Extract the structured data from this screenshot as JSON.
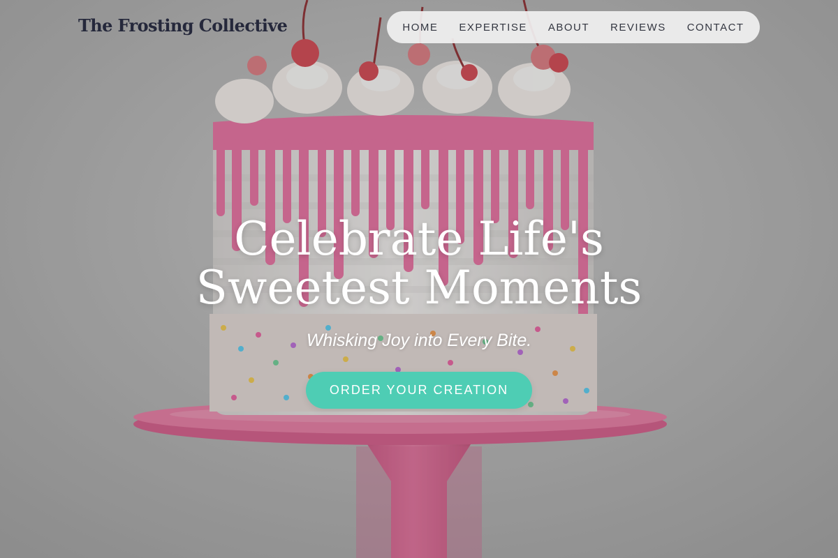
{
  "brand": {
    "name": "The Frosting Collective"
  },
  "nav": {
    "items": [
      {
        "label": "HOME"
      },
      {
        "label": "EXPERTISE"
      },
      {
        "label": "ABOUT"
      },
      {
        "label": "REVIEWS"
      },
      {
        "label": "CONTACT"
      }
    ]
  },
  "hero": {
    "title_line1": "Celebrate Life's",
    "title_line2": "Sweetest Moments",
    "tagline": "Whisking Joy into Every Bite.",
    "cta_label": "ORDER YOUR CREATION",
    "image_subject": "pink drip cake with cherries and sprinkles on a pink cake stand"
  },
  "colors": {
    "accent": "#4ecdb4",
    "logo_text": "#25283b",
    "nav_background": "#f1f1f1",
    "cake_pink": "#e8699b",
    "background": "#a7a7a7"
  }
}
